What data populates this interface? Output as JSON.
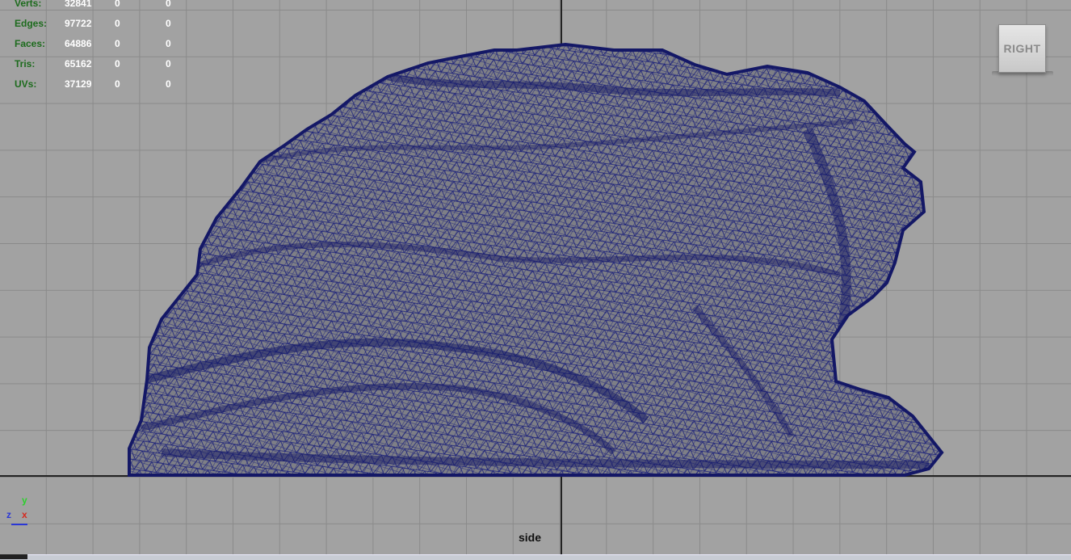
{
  "hud": {
    "rows": [
      {
        "label": "Verts:",
        "v1": "32841",
        "v2": "0",
        "v3": "0"
      },
      {
        "label": "Edges:",
        "v1": "97722",
        "v2": "0",
        "v3": "0"
      },
      {
        "label": "Faces:",
        "v1": "64886",
        "v2": "0",
        "v3": "0"
      },
      {
        "label": "Tris:",
        "v1": "65162",
        "v2": "0",
        "v3": "0"
      },
      {
        "label": "UVs:",
        "v1": "37129",
        "v2": "0",
        "v3": "0"
      }
    ]
  },
  "view_cube": {
    "label": "RIGHT"
  },
  "axis_gizmo": {
    "y": "y",
    "z": "z",
    "x": "x"
  },
  "camera": {
    "name": "side"
  },
  "colors": {
    "background": "#a2a2a2",
    "grid": "#8a8a8a",
    "wireframe": "#1a1f7a",
    "hud_label": "#1d6b1d",
    "hud_value": "#ffffff"
  }
}
